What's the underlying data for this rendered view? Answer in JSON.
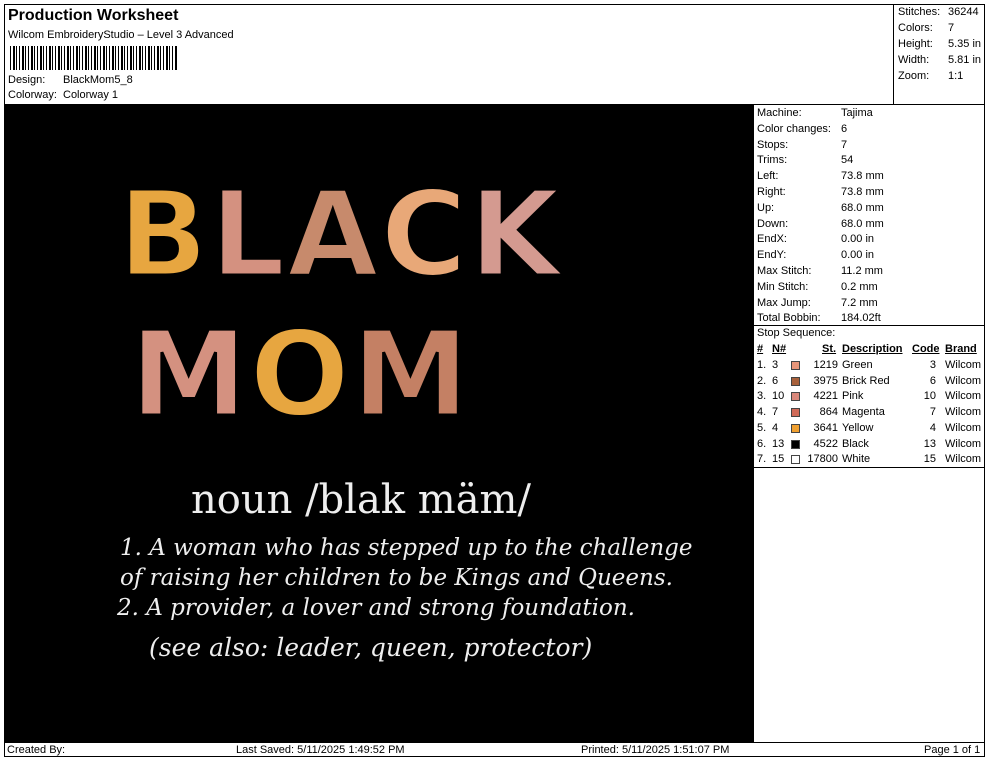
{
  "header": {
    "title": "Production Worksheet",
    "software": "Wilcom EmbroideryStudio – Level 3 Advanced",
    "design_label": "Design:",
    "design_value": "BlackMom5_8",
    "colorway_label": "Colorway:",
    "colorway_value": "Colorway 1"
  },
  "stats": [
    {
      "label": "Stitches:",
      "value": "36244"
    },
    {
      "label": "Colors:",
      "value": "7"
    },
    {
      "label": "Height:",
      "value": "5.35 in"
    },
    {
      "label": "Width:",
      "value": "5.81 in"
    },
    {
      "label": "Zoom:",
      "value": "1:1"
    }
  ],
  "machine_info": [
    {
      "label": "Machine:",
      "value": "Tajima"
    },
    {
      "label": "Color changes:",
      "value": "6"
    },
    {
      "label": "Stops:",
      "value": "7"
    },
    {
      "label": "Trims:",
      "value": "54"
    },
    {
      "label": "Left:",
      "value": "73.8 mm"
    },
    {
      "label": "Right:",
      "value": "73.8 mm"
    },
    {
      "label": "Up:",
      "value": "68.0 mm"
    },
    {
      "label": "Down:",
      "value": "68.0 mm"
    },
    {
      "label": "EndX:",
      "value": "0.00 in"
    },
    {
      "label": "EndY:",
      "value": "0.00 in"
    },
    {
      "label": "Max Stitch:",
      "value": "11.2 mm"
    },
    {
      "label": "Min Stitch:",
      "value": "0.2 mm"
    },
    {
      "label": "Max Jump:",
      "value": "7.2 mm"
    },
    {
      "label": "Total Bobbin:",
      "value": "184.02ft"
    }
  ],
  "stop_sequence": {
    "title": "Stop Sequence:",
    "headers": {
      "num": "#",
      "needle": "N#",
      "st": "St.",
      "description": "Description",
      "code": "Code",
      "brand": "Brand"
    },
    "rows": [
      {
        "num": "1.",
        "needle": "3",
        "color": "#e8967a",
        "st": "1219",
        "description": "Green",
        "code": "3",
        "brand": "Wilcom"
      },
      {
        "num": "2.",
        "needle": "6",
        "color": "#a8603a",
        "st": "3975",
        "description": "Brick Red",
        "code": "6",
        "brand": "Wilcom"
      },
      {
        "num": "3.",
        "needle": "10",
        "color": "#d9877a",
        "st": "4221",
        "description": "Pink",
        "code": "10",
        "brand": "Wilcom"
      },
      {
        "num": "4.",
        "needle": "7",
        "color": "#d06a58",
        "st": "864",
        "description": "Magenta",
        "code": "7",
        "brand": "Wilcom"
      },
      {
        "num": "5.",
        "needle": "4",
        "color": "#f0a030",
        "st": "3641",
        "description": "Yellow",
        "code": "4",
        "brand": "Wilcom"
      },
      {
        "num": "6.",
        "needle": "13",
        "color": "#000000",
        "st": "4522",
        "description": "Black",
        "code": "13",
        "brand": "Wilcom"
      },
      {
        "num": "7.",
        "needle": "15",
        "color": "#ffffff",
        "st": "17800",
        "description": "White",
        "code": "15",
        "brand": "Wilcom"
      }
    ]
  },
  "design": {
    "line1": "BLACK",
    "line2": "MOM",
    "pron": "noun /blak mäm/",
    "def1": "1. A woman who has stepped up to the challenge",
    "def2": "of  raising her children to be Kings and Queens.",
    "def3": "2. A provider, a lover and strong foundation.",
    "also": "(see also: leader,  queen, protector)",
    "letter_colors": [
      "#e7a640",
      "#d49180",
      "#c78a6c",
      "#e8a878",
      "#d49a90",
      "#d49180",
      "#e7a640",
      "#c48064"
    ]
  },
  "footer": {
    "created": "Created By:",
    "saved": "Last Saved: 5/11/2025 1:49:52 PM",
    "printed": "Printed: 5/11/2025 1:51:07 PM",
    "page": "Page 1 of 1"
  }
}
